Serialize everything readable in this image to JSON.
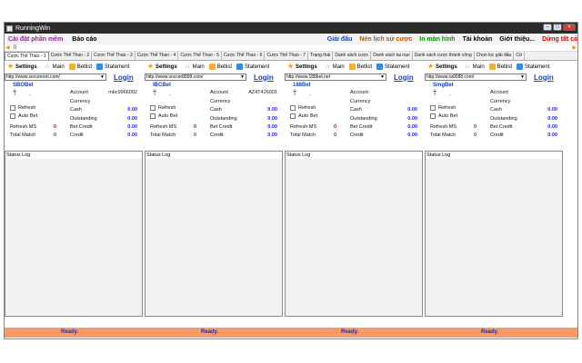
{
  "window": {
    "title": "RunningWin",
    "controls": [
      "–",
      "□",
      "×"
    ]
  },
  "menu": {
    "left": [
      {
        "label": "Cài đặt phần mềm",
        "color": "#9a1ea0"
      },
      {
        "label": "Báo cáo",
        "color": "#111111"
      }
    ],
    "right": [
      {
        "label": "Giải đấu",
        "color": "#1a3fb0"
      },
      {
        "label": "Nén lịch sử cược",
        "color": "#c05000"
      },
      {
        "label": "In màn hình",
        "color": "#0a8a0a"
      },
      {
        "label": "Tài khoản",
        "color": "#111111"
      },
      {
        "label": "Giới thiệu...",
        "color": "#111111"
      },
      {
        "label": "Dừng tất cả",
        "color": "#e00000"
      }
    ]
  },
  "ticker": {
    "value": "0"
  },
  "tabs": [
    "Cược Thể Thao - 1",
    "Cược Thể Thao - 2",
    "Cược Thể Thao - 3",
    "Cược Thể Thao - 4",
    "Cược Thể Thao - 5",
    "Cược Thể Thao - 6",
    "Cược Thể Thao - 7",
    "Trạng thái",
    "Danh sách cược",
    "Danh sách tai nạn",
    "Danh sách cược thành công",
    "Chọn lọc giải đấu",
    "Cừ"
  ],
  "toolbar": {
    "settings": "Settings",
    "main": "Main",
    "betlist": "Betlist",
    "statement": "Statement"
  },
  "labels": {
    "account": "Account",
    "currency": "Currency",
    "cash": "Cash",
    "outstanding": "Outstanding",
    "refresh": "Refresh",
    "auto_bet": "Auto Bet",
    "refresh_ms": "Refresh MS",
    "bet_credit": "Bet Credit",
    "total_match": "Total Match",
    "credit": "Credit",
    "status_log": "Status Log",
    "login": "Login",
    "t_glyph": "Ť",
    "dash": "-",
    "ready": "Ready."
  },
  "panes": [
    {
      "name": "SBOBet",
      "url": "http://www.secureron.com/",
      "account": "mbc9966002",
      "cash": "0.00",
      "outstanding": "0.00",
      "refresh_ms": "0",
      "bet_credit": "0.00",
      "total_match": "0",
      "credit": "0.00"
    },
    {
      "name": "IBCBet",
      "url": "http://www.soccer8899.com/",
      "account": "AZ4T426001",
      "cash": "0.00",
      "outstanding": "0.00",
      "refresh_ms": "0",
      "bet_credit": "0.00",
      "total_match": "0",
      "credit": "0.00"
    },
    {
      "name": "188Bet",
      "url": "http://www.188bet.net",
      "account": "",
      "cash": "0.00",
      "outstanding": "0.00",
      "refresh_ms": "0",
      "bet_credit": "0.00",
      "total_match": "0",
      "credit": "0.00"
    },
    {
      "name": "SingBet",
      "url": "http://www.ra0088.com/",
      "account": "",
      "cash": "0.00",
      "outstanding": "0.00",
      "refresh_ms": "0",
      "bet_credit": "0.00",
      "total_match": "0",
      "credit": "0.00"
    }
  ]
}
